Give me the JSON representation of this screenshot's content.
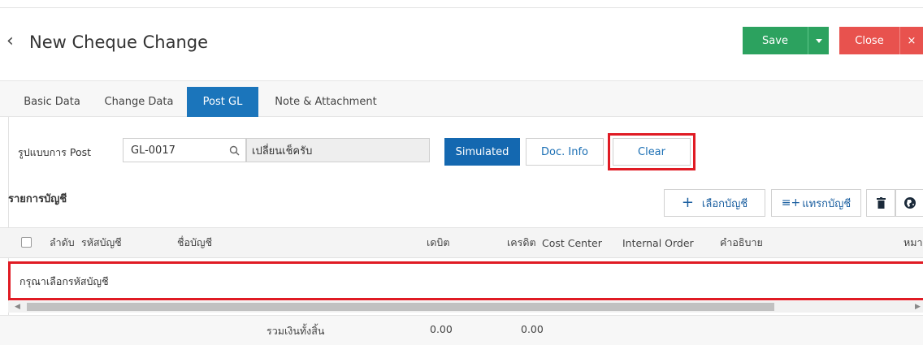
{
  "header": {
    "back_icon": "chevron-left-icon",
    "title": "New Cheque Change",
    "save_label": "Save",
    "close_label": "Close",
    "close_x": "×"
  },
  "tabs": [
    {
      "label": "Basic Data",
      "active": false
    },
    {
      "label": "Change Data",
      "active": false
    },
    {
      "label": "Post GL",
      "active": true
    },
    {
      "label": "Note & Attachment",
      "active": false
    }
  ],
  "post": {
    "label": "รูปแบบการ Post",
    "code_value": "GL-0017",
    "description_value": "เปลี่ยนเช็ครับ",
    "simulated_label": "Simulated",
    "doc_info_label": "Doc. Info",
    "clear_label": "Clear"
  },
  "accounts": {
    "section_title": "รายการบัญชี",
    "select_account_label": "เลือกบัญชี",
    "insert_account_label": "แทรกบัญชี",
    "columns": [
      "ลำดับ",
      "รหัสบัญชี",
      "ชื่อบัญชี",
      "เดบิต",
      "เครดิต",
      "Cost Center",
      "Internal Order",
      "คำอธิบาย",
      "หมา"
    ],
    "empty_message": "กรุณาเลือกรหัสบัญชี",
    "total_label": "รวมเงินทั้งสิ้น",
    "total_debit": "0.00",
    "total_credit": "0.00"
  },
  "colors": {
    "save": "#2ca25f",
    "close": "#e8524e",
    "active_tab": "#1b75bb",
    "highlight": "#e01b24"
  }
}
